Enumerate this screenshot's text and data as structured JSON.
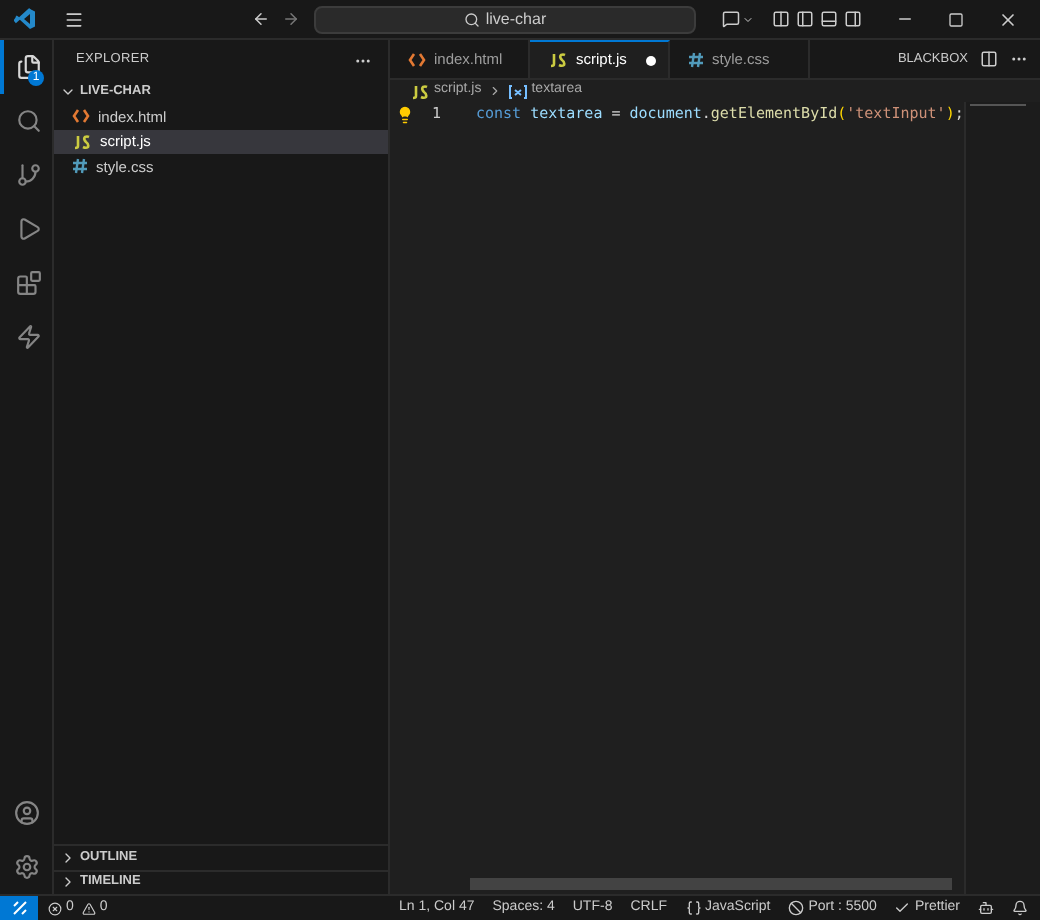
{
  "title_bar": {
    "search": "live-char"
  },
  "activity_bar": {
    "items": [
      {
        "selected": true,
        "badge": "1"
      },
      {
        "selected": false
      },
      {
        "selected": false
      },
      {
        "selected": false
      },
      {
        "selected": false
      },
      {
        "selected": false
      }
    ]
  },
  "sidebar": {
    "title": "EXPLORER",
    "folder": {
      "name": "LIVE-CHAR",
      "expanded": true,
      "files": [
        {
          "name": "index.html",
          "kind": "html",
          "selected": false
        },
        {
          "name": "script.js",
          "kind": "js",
          "selected": true
        },
        {
          "name": "style.css",
          "kind": "css",
          "selected": false
        }
      ]
    },
    "sections": [
      {
        "name": "OUTLINE",
        "expanded": false
      },
      {
        "name": "TIMELINE",
        "expanded": false
      }
    ]
  },
  "tabs": [
    {
      "label": "index.html",
      "kind": "html",
      "selected": false,
      "modified": false
    },
    {
      "label": "script.js",
      "kind": "js",
      "selected": true,
      "modified": true
    },
    {
      "label": "style.css",
      "kind": "css",
      "selected": false,
      "modified": false
    }
  ],
  "editor_actions": {
    "label": "BLACKBOX"
  },
  "breadcrumb": [
    {
      "label": "script.js",
      "kind": "js"
    },
    {
      "label": "textarea",
      "kind": "variable"
    }
  ],
  "code_lines": [
    {
      "number": "1",
      "tokens": [
        {
          "text": "const ",
          "kind": "keyword"
        },
        {
          "text": "textarea",
          "kind": "variable"
        },
        {
          "text": " = ",
          "kind": "plain"
        },
        {
          "text": "document",
          "kind": "variable"
        },
        {
          "text": ".",
          "kind": "plain"
        },
        {
          "text": "getElementById",
          "kind": "function"
        },
        {
          "text": "(",
          "kind": "bracket"
        },
        {
          "text": "'textInput'",
          "kind": "string"
        },
        {
          "text": ")",
          "kind": "bracket"
        },
        {
          "text": ";",
          "kind": "plain"
        }
      ]
    }
  ],
  "status_bar": {
    "errors": "0",
    "warnings": "0",
    "items": [
      {
        "text": "Ln 1, Col 47",
        "kind": "text"
      },
      {
        "text": "Spaces: 4",
        "kind": "text"
      },
      {
        "text": "UTF-8",
        "kind": "text"
      },
      {
        "text": "CRLF",
        "kind": "text"
      },
      {
        "text": "JavaScript",
        "kind": "language"
      },
      {
        "text": "Port : 5500",
        "kind": "port"
      },
      {
        "text": "Prettier",
        "kind": "check"
      }
    ]
  }
}
